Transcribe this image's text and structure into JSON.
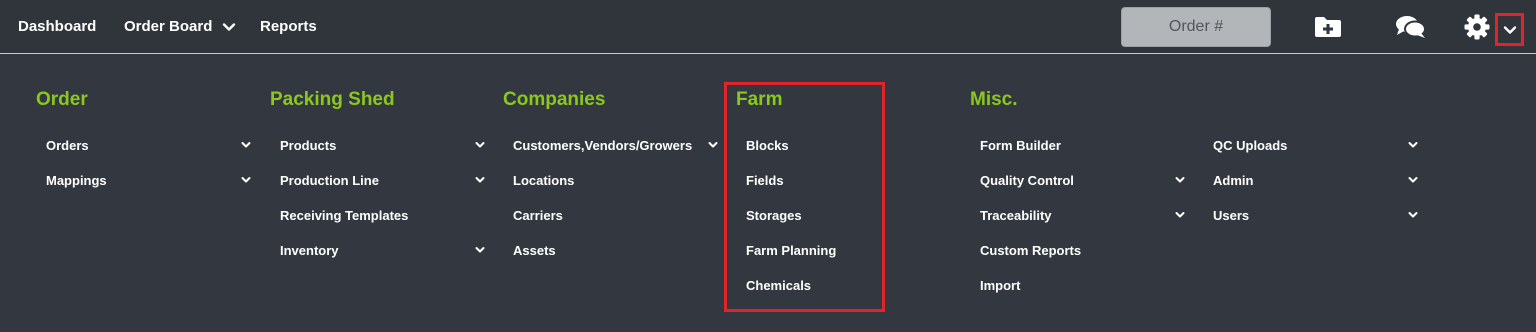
{
  "topbar": {
    "dashboard": "Dashboard",
    "order_board": "Order Board",
    "reports": "Reports",
    "order_search_placeholder": "Order #",
    "icons": [
      "folder-plus-icon",
      "chat-icon",
      "gear-icon",
      "chevron-down-icon"
    ]
  },
  "menu": {
    "order": {
      "title": "Order",
      "items": [
        {
          "label": "Orders",
          "has_submenu": true
        },
        {
          "label": "Mappings",
          "has_submenu": true
        }
      ]
    },
    "packing_shed": {
      "title": "Packing Shed",
      "items": [
        {
          "label": "Products",
          "has_submenu": true
        },
        {
          "label": "Production Line",
          "has_submenu": true
        },
        {
          "label": "Receiving Templates",
          "has_submenu": false
        },
        {
          "label": "Inventory",
          "has_submenu": true
        }
      ]
    },
    "companies": {
      "title": "Companies",
      "items": [
        {
          "label": "Customers,Vendors/Growers",
          "has_submenu": true
        },
        {
          "label": "Locations",
          "has_submenu": false
        },
        {
          "label": "Carriers",
          "has_submenu": false
        },
        {
          "label": "Assets",
          "has_submenu": false
        }
      ]
    },
    "farm": {
      "title": "Farm",
      "items": [
        {
          "label": "Blocks",
          "has_submenu": false
        },
        {
          "label": "Fields",
          "has_submenu": false
        },
        {
          "label": "Storages",
          "has_submenu": false
        },
        {
          "label": "Farm Planning",
          "has_submenu": false
        },
        {
          "label": "Chemicals",
          "has_submenu": false
        }
      ]
    },
    "misc": {
      "title": "Misc.",
      "items": [
        {
          "label": "Form Builder",
          "has_submenu": false
        },
        {
          "label": "Quality Control",
          "has_submenu": true
        },
        {
          "label": "Traceability",
          "has_submenu": true
        },
        {
          "label": "Custom Reports",
          "has_submenu": false
        },
        {
          "label": "Import",
          "has_submenu": false
        }
      ]
    },
    "misc2": {
      "items": [
        {
          "label": "QC Uploads",
          "has_submenu": true
        },
        {
          "label": "Admin",
          "has_submenu": true
        },
        {
          "label": "Users",
          "has_submenu": true
        }
      ]
    }
  },
  "colors": {
    "background": "#333840",
    "topbar": "#2f353b",
    "heading_green": "#8bc81e",
    "highlight_red": "#e0242b"
  }
}
